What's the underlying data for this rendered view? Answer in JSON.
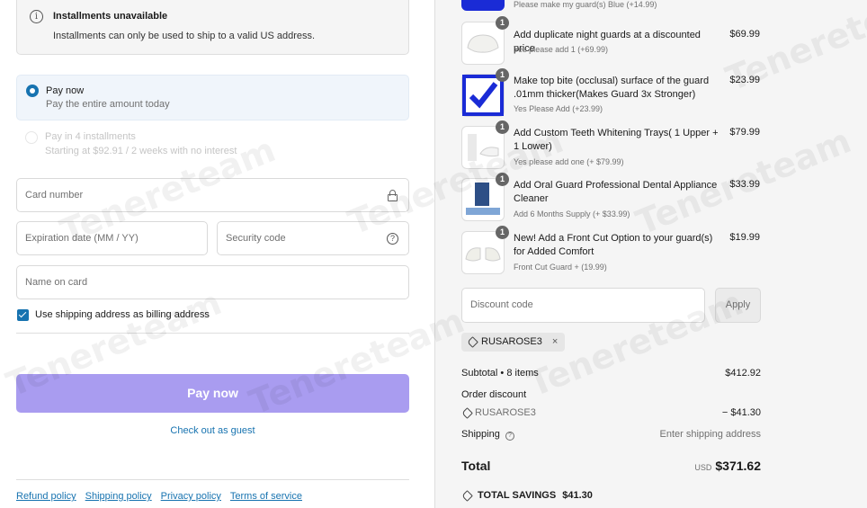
{
  "notice": {
    "title": "Installments unavailable",
    "body": "Installments can only be used to ship to a valid US address."
  },
  "payment": {
    "pay_now_title": "Pay now",
    "pay_now_sub": "Pay the entire amount today",
    "pay_4_title": "Pay in 4 installments",
    "pay_4_sub": "Starting at $92.91 / 2 weeks with no interest"
  },
  "fields": {
    "card_number": "Card number",
    "expiration": "Expiration date (MM / YY)",
    "security_code": "Security code",
    "name_on_card": "Name on card"
  },
  "billing_checkbox_label": "Use shipping address as billing address",
  "pay_button": "Pay now",
  "guest_link": "Check out as guest",
  "footer_links": [
    "Refund policy",
    "Shipping policy",
    "Privacy policy",
    "Terms of service"
  ],
  "items": [
    {
      "qty": "1",
      "name": "Please make my guard(s) Blue (+14.99)",
      "sub": "",
      "price": ""
    },
    {
      "qty": "1",
      "name": "Add duplicate night guards at a discounted price",
      "sub": "Yes please add 1 (+69.99)",
      "price": "$69.99"
    },
    {
      "qty": "1",
      "name": "Make top bite (occlusal) surface of the guard .01mm thicker(Makes Guard 3x Stronger)",
      "sub": "Yes Please Add (+23.99)",
      "price": "$23.99"
    },
    {
      "qty": "1",
      "name": "Add Custom Teeth Whitening Trays( 1 Upper + 1 Lower)",
      "sub": "Yes please add one (+ $79.99)",
      "price": "$79.99"
    },
    {
      "qty": "1",
      "name": "Add Oral Guard Professional Dental Appliance Cleaner",
      "sub": "Add 6 Months Supply (+ $33.99)",
      "price": "$33.99"
    },
    {
      "qty": "1",
      "name": "New! Add a Front Cut Option to your guard(s) for Added Comfort",
      "sub": "Front Cut Guard + (19.99)",
      "price": "$19.99"
    }
  ],
  "discount": {
    "placeholder": "Discount code",
    "apply": "Apply",
    "applied_code": "RUSAROSE3",
    "remove": "×"
  },
  "summary": {
    "subtotal_label": "Subtotal • 8 items",
    "subtotal_value": "$412.92",
    "order_discount_label": "Order discount",
    "discount_code": "RUSAROSE3",
    "discount_value": "− $41.30",
    "shipping_label": "Shipping",
    "shipping_value": "Enter shipping address",
    "total_label": "Total",
    "currency": "USD",
    "total_value": "$371.62",
    "savings_label": "TOTAL SAVINGS",
    "savings_value": "$41.30"
  },
  "watermark": "Tenereteam",
  "colors": {
    "accent": "#1773b0",
    "pay_button": "#a99cf0",
    "blue_guard": "#1a2bd6"
  }
}
